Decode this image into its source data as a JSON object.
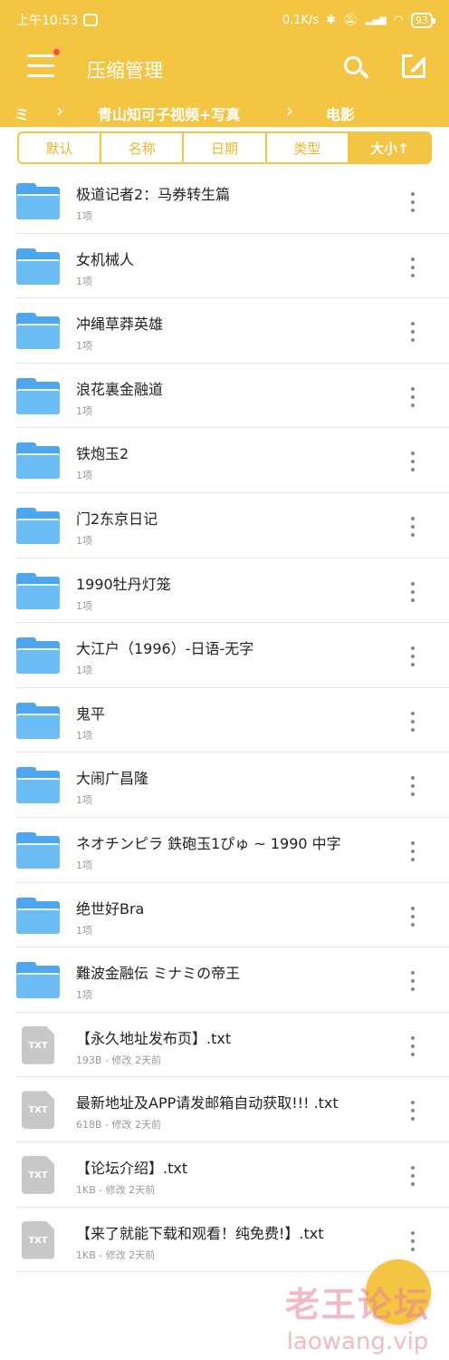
{
  "status": {
    "time": "上午10:53",
    "speed": "0.1K/s",
    "signal": "HD",
    "battery": "93"
  },
  "app_bar": {
    "title": "压缩管理"
  },
  "breadcrumb": [
    "ミ",
    "青山知可子视频+写真",
    "电影"
  ],
  "sort_tabs": [
    "默认",
    "名称",
    "日期",
    "类型",
    "大小↑"
  ],
  "items": [
    {
      "title": "极道记者2：马券转生篇",
      "sub": "1项",
      "type": "folder"
    },
    {
      "title": "女机械人",
      "sub": "1项",
      "type": "folder"
    },
    {
      "title": "冲绳草莽英雄",
      "sub": "1项",
      "type": "folder"
    },
    {
      "title": "浪花裏金融道",
      "sub": "1项",
      "type": "folder"
    },
    {
      "title": "铁炮玉2",
      "sub": "1项",
      "type": "folder"
    },
    {
      "title": "门2东京日记",
      "sub": "1项",
      "type": "folder"
    },
    {
      "title": "1990牡丹灯笼",
      "sub": "1项",
      "type": "folder"
    },
    {
      "title": "大江户（1996）-日语-无字",
      "sub": "1项",
      "type": "folder"
    },
    {
      "title": "鬼平",
      "sub": "1项",
      "type": "folder"
    },
    {
      "title": "大闹广昌隆",
      "sub": "1项",
      "type": "folder"
    },
    {
      "title": "ネオチンピラ 鉄砲玉1ぴゅ ~ 1990 中字",
      "sub": "1项",
      "type": "folder"
    },
    {
      "title": "绝世好Bra",
      "sub": "1项",
      "type": "folder"
    },
    {
      "title": "難波金融伝 ミナミの帝王",
      "sub": "1项",
      "type": "folder"
    },
    {
      "title": "【永久地址发布页】.txt",
      "sub": "193B - 修改 2天前",
      "type": "txt"
    },
    {
      "title": "最新地址及APP请发邮箱自动获取!!! .txt",
      "sub": "618B - 修改 2天前",
      "type": "txt"
    },
    {
      "title": "【论坛介绍】.txt",
      "sub": "1KB - 修改 2天前",
      "type": "txt"
    },
    {
      "title": "【来了就能下载和观看！纯免费!】.txt",
      "sub": "1KB - 修改 2天前",
      "type": "txt"
    }
  ],
  "file_icon_label": "TXT",
  "watermark": {
    "cn": "老王论坛",
    "en": "laowang.vip"
  },
  "colors": {
    "accent": "#f4c542",
    "folder": "#4ea7ee",
    "file": "#c8c8c8"
  }
}
